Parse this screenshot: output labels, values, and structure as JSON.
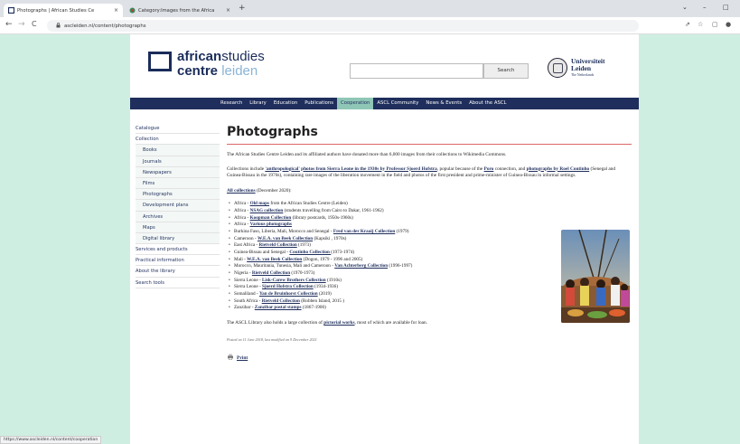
{
  "browser": {
    "tabs": [
      {
        "title": "Photographs | African Studies Ce",
        "close": "×"
      },
      {
        "title": "Category:Images from the Africa",
        "close": "×"
      }
    ],
    "new_tab": "+",
    "controls": {
      "minimize": "–",
      "maximize": "□",
      "caret": "⌄"
    },
    "url": "ascleiden.nl/content/photographs",
    "nav": {
      "back": "←",
      "forward": "→",
      "reload": "C"
    },
    "right_icons": {
      "share": "⇗",
      "star": "☆",
      "side": "▢",
      "profile": "●"
    },
    "status": "https://www.ascleiden.nl/content/cooperation"
  },
  "header": {
    "logo": {
      "word1a": "african",
      "word1b": "studies",
      "word2a": "centre",
      "word2b": "leiden"
    },
    "search": {
      "placeholder": "",
      "button": "Search"
    },
    "university": {
      "line1": "Universiteit",
      "line2": "Leiden",
      "line3": "The Netherlands"
    }
  },
  "nav": {
    "items": [
      "Research",
      "Library",
      "Education",
      "Publications",
      "Cooperation",
      "ASCL Community",
      "News & Events",
      "About the ASCL"
    ],
    "active": "Cooperation"
  },
  "sidebar": {
    "items": [
      {
        "label": "Catalogue",
        "sub": false
      },
      {
        "label": "Collection",
        "sub": false
      },
      {
        "label": "Books",
        "sub": true
      },
      {
        "label": "Journals",
        "sub": true
      },
      {
        "label": "Newspapers",
        "sub": true
      },
      {
        "label": "Films",
        "sub": true
      },
      {
        "label": "Photographs",
        "sub": true
      },
      {
        "label": "Development plans",
        "sub": true
      },
      {
        "label": "Archives",
        "sub": true
      },
      {
        "label": "Maps",
        "sub": true
      },
      {
        "label": "Digital library",
        "sub": true
      },
      {
        "label": "Services and products",
        "sub": false
      },
      {
        "label": "Practical information",
        "sub": false
      },
      {
        "label": "About the library",
        "sub": false
      },
      {
        "label": "Search tools",
        "sub": false
      }
    ]
  },
  "content": {
    "title": "Photographs",
    "intro": "The African Studies Centre Leiden and its affiliated authors have donated more than 6,000 images from their collections to Wikimedia Commons.",
    "p2": {
      "t1": "Collections include ",
      "l1": "'anthropological' photos from Sierra Leone in the 1930s by Professor Sjoerd Hofstra",
      "t2": ", popular because of the ",
      "l2": "Poro",
      "t3": " connection, and ",
      "l3": "photographs by Roel Coutinho",
      "t4": " (Senegal and Guinea-Bissau in the 1970s), containing rare images of the liberation movement in the field and photos of the first president and prime-minister of Guinea-Bissau in informal settings."
    },
    "all": {
      "link": "All collections",
      "rest": " (December 2020):"
    },
    "collections": [
      {
        "pre": "Africa - ",
        "link": "Old maps",
        "post": " from the African Studies Centre (Leiden)"
      },
      {
        "pre": "Africa - ",
        "link": "NSAG collection",
        "post": " (students travelling from Cairo to Dakar, 1961-1962)"
      },
      {
        "pre": "Africa - ",
        "link": "Koopman Collection",
        "post": " (library postcards, 1950s-1960s)"
      },
      {
        "pre": "Africa - ",
        "link": "Various photographs",
        "post": ""
      },
      {
        "pre": "Burkina Faso, Liberia, Mali, Morocco and Senegal - ",
        "link": "Fred van der Kraaij Collection",
        "post": " (1979)"
      },
      {
        "pre": "Cameroon - ",
        "link": "W.E.A. van Beek Collection",
        "post": " (Kapsiki , 1970s)"
      },
      {
        "pre": "East Africa - ",
        "link": "Rietveld Collection",
        "post": " (1973)"
      },
      {
        "pre": "Guinea-Bissau and Senegal - ",
        "link": "Coutinho Collection ",
        "post": "(1973-1974)"
      },
      {
        "pre": "Mali - ",
        "link": "W.E.A. van Beek Collection",
        "post": " (Dogon, 1979 - 1996 and 2005)"
      },
      {
        "pre": "Morocco, Mauritania, Tunesia, Mali and Cameroon - ",
        "link": "Van Achterberg Collection",
        "post": " (1996-1997)"
      },
      {
        "pre": "Nigeria - ",
        "link": "Rietveld Collection",
        "post": " (1970-1973)"
      },
      {
        "pre": "Sierra Leone - ",
        "link": "Lisk-Carew Brothers Collection",
        "post": " (1910s)"
      },
      {
        "pre": "Sierra Leone - ",
        "link": "Sjoerd Hofstra Collection",
        "post": " (1934-1936)"
      },
      {
        "pre": "Somaliland - ",
        "link": "Yan de Bruinhorst Collection",
        "post": " (2019)"
      },
      {
        "pre": "South Africa - ",
        "link": "Rietveld Collection",
        "post": " (Robben Island, 2015 )"
      },
      {
        "pre": "Zanzibar - ",
        "link": "Zanzibar postal stamps",
        "post": " (1867-1900)"
      }
    ],
    "library": {
      "t1": "The ASCL Library also holds a large collection of ",
      "link": "pictorial works",
      "t2": ", most of which are available for loan."
    },
    "posted": "Posted on 11 June 2018, last modified on 9 December 2021",
    "print": "Print"
  }
}
